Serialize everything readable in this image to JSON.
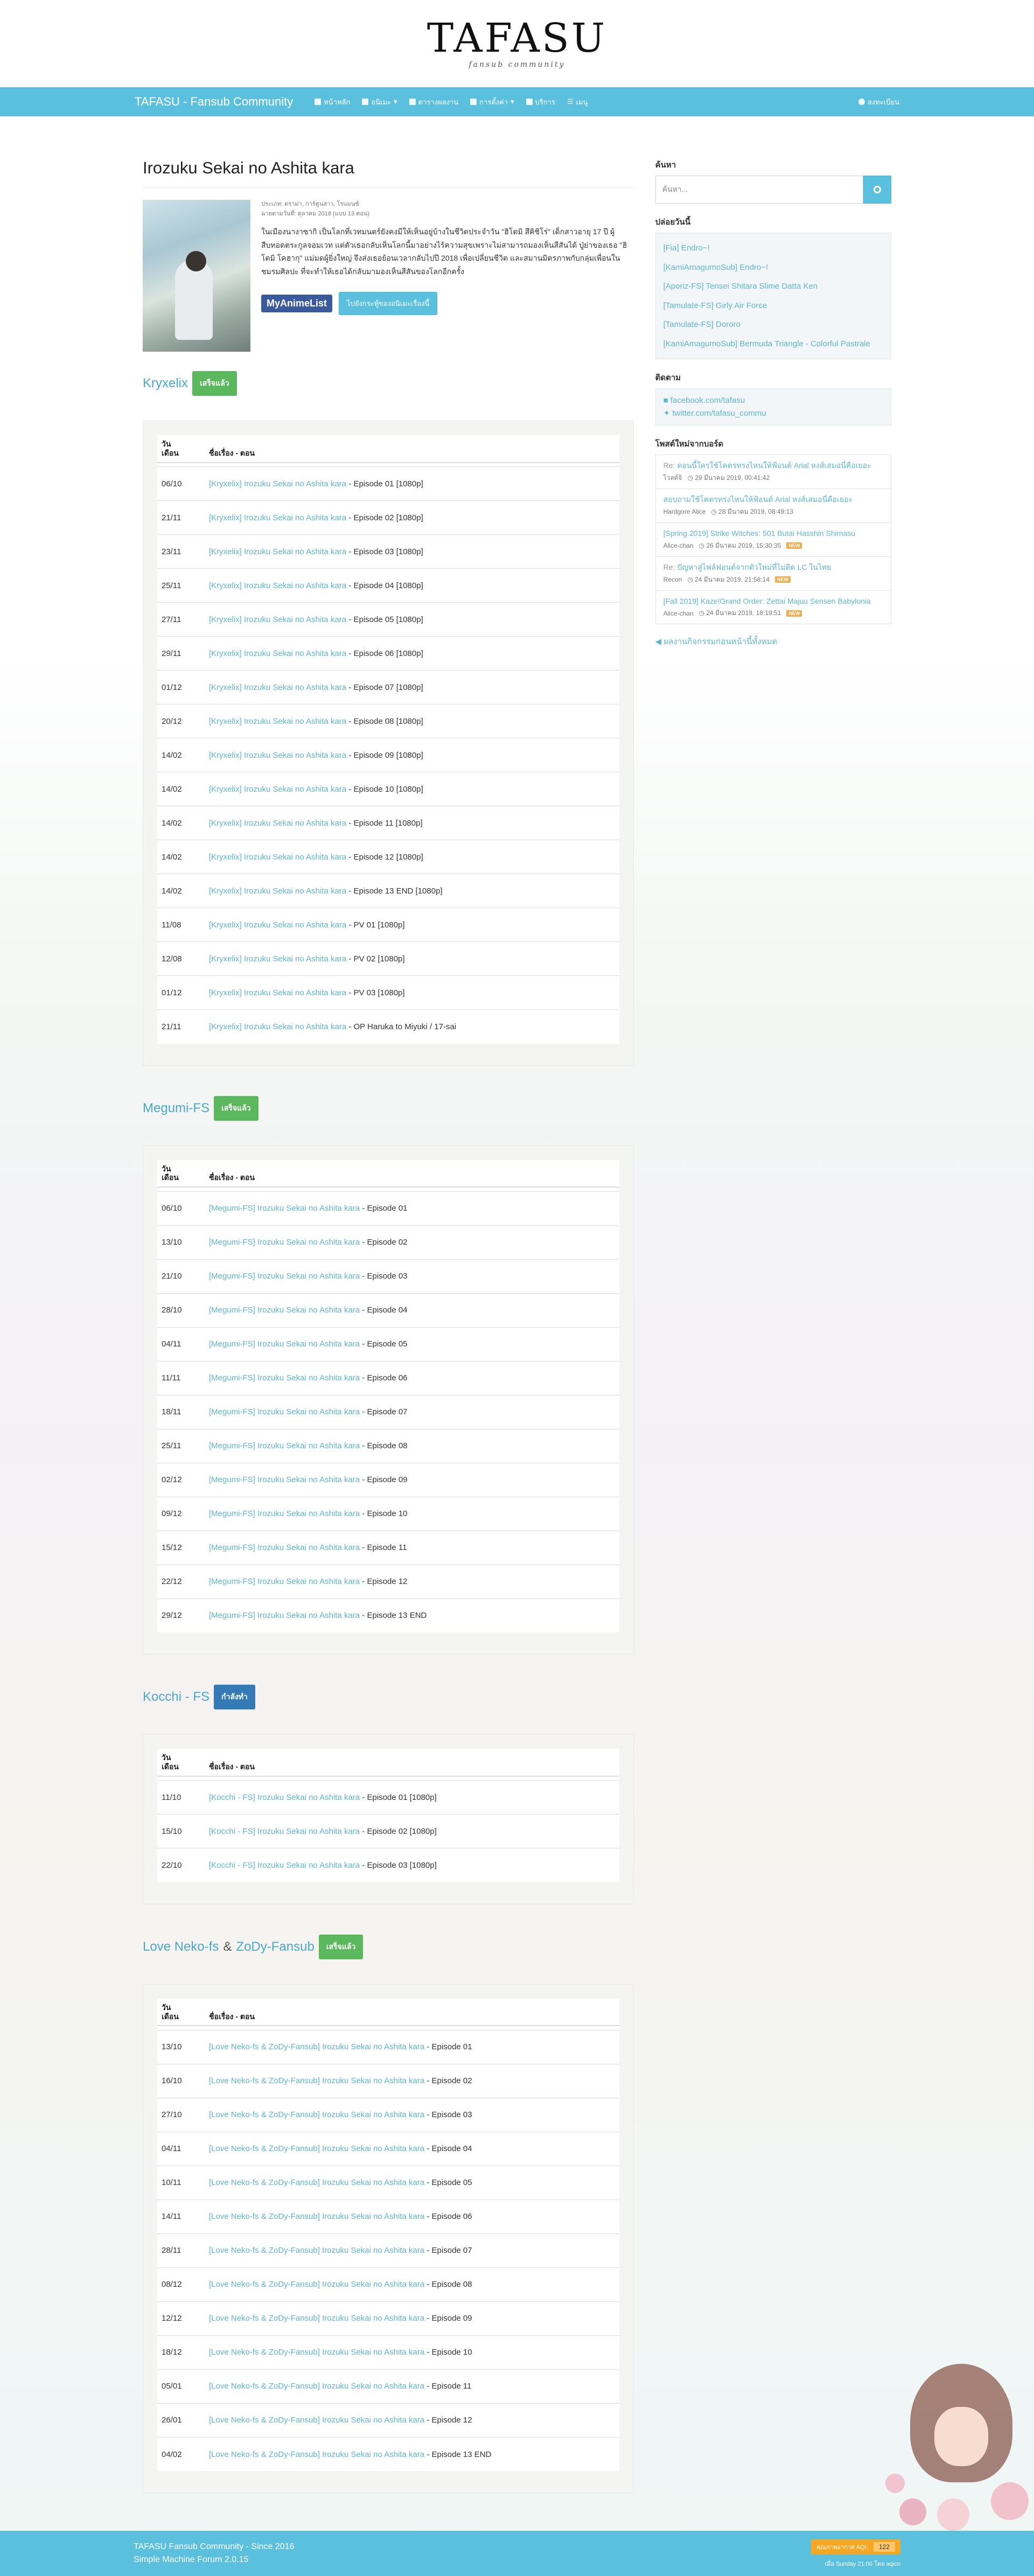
{
  "logo": {
    "title": "TAFASU",
    "subtitle": "fansub community"
  },
  "nav": {
    "brand": "TAFASU - Fansub Community",
    "items": [
      "หน้าหลัก",
      "อนิเมะ",
      "ตารางผลงาน",
      "การตั้งค่า",
      "บริการ",
      "เมนู"
    ],
    "login": "ลงทะเบียน"
  },
  "anime": {
    "title": "Irozuku Sekai no Ashita kara",
    "meta_line1": "ประเภท: ดราม่า, การ์ตูนสาว, โรแมนซ์",
    "meta_line2": "ฉายตามวันที่: ตุลาคม 2018 (แบบ 13 ตอน)",
    "synopsis": "ในเมืองนางาซากิ เป็นโลกที่เวทมนตร์ยังคงมีให้เห็นอยู่บ้างในชีวิตประจำวัน \"ฮิโตมิ สึคิชิโร่\" เด็กสาวอายุ 17 ปี ผู้สืบทอดตระกูลจอมเวท แต่ตัวเธอกลับเห็นโลกนี้มาอย่างไร้ความสุขเพราะไม่สามารถมองเห็นสีสันได้ ปู่ย่าของเธอ \"ฮิโตมิ โคฮากุ\" แม่มดผู้ยิ่งใหญ่ จึงส่งเธอย้อนเวลากลับไปปี 2018 เพื่อเปลี่ยนชีวิต และสมานมิตรภาพกับกลุ่มเพื่อนในชมรมศิลปะ ที่จะทำให้เธอได้กลับมามองเห็นสีสันของโลกอีกครั้ง",
    "mal_label": "MyAnimeList",
    "info_button": "ไปยังกระทู้ของอนิเมะเรื่องนี้"
  },
  "table_headers": {
    "date": "วัน\nเดือน",
    "title": "ชื่อเรื่อง - ตอน"
  },
  "groups": [
    {
      "name": "Kryxelix",
      "status": "เสร็จแล้ว",
      "status_type": "done",
      "rows": [
        {
          "date": "06/10",
          "link": "[Kryxelix] Irozuku Sekai no Ashita kara",
          "ep": "Episode 01 [1080p]"
        },
        {
          "date": "21/11",
          "link": "[Kryxelix] Irozuku Sekai no Ashita kara",
          "ep": "Episode 02 [1080p]"
        },
        {
          "date": "23/11",
          "link": "[Kryxelix] Irozuku Sekai no Ashita kara",
          "ep": "Episode 03 [1080p]"
        },
        {
          "date": "25/11",
          "link": "[Kryxelix] Irozuku Sekai no Ashita kara",
          "ep": "Episode 04 [1080p]"
        },
        {
          "date": "27/11",
          "link": "[Kryxelix] Irozuku Sekai no Ashita kara",
          "ep": "Episode 05 [1080p]"
        },
        {
          "date": "29/11",
          "link": "[Kryxelix] Irozuku Sekai no Ashita kara",
          "ep": "Episode 06 [1080p]"
        },
        {
          "date": "01/12",
          "link": "[Kryxelix] Irozuku Sekai no Ashita kara",
          "ep": "Episode 07 [1080p]"
        },
        {
          "date": "20/12",
          "link": "[Kryxelix] Irozuku Sekai no Ashita kara",
          "ep": "Episode 08 [1080p]"
        },
        {
          "date": "14/02",
          "link": "[Kryxelix] Irozuku Sekai no Ashita kara",
          "ep": "Episode 09 [1080p]"
        },
        {
          "date": "14/02",
          "link": "[Kryxelix] Irozuku Sekai no Ashita kara",
          "ep": "Episode 10 [1080p]"
        },
        {
          "date": "14/02",
          "link": "[Kryxelix] Irozuku Sekai no Ashita kara",
          "ep": "Episode 11 [1080p]"
        },
        {
          "date": "14/02",
          "link": "[Kryxelix] Irozuku Sekai no Ashita kara",
          "ep": "Episode 12 [1080p]"
        },
        {
          "date": "14/02",
          "link": "[Kryxelix] Irozuku Sekai no Ashita kara",
          "ep": "Episode 13 END [1080p]"
        },
        {
          "date": "11/08",
          "link": "[Kryxelix] Irozuku Sekai no Ashita kara",
          "ep": "PV 01 [1080p]"
        },
        {
          "date": "12/08",
          "link": "[Kryxelix] Irozuku Sekai no Ashita kara",
          "ep": "PV 02 [1080p]"
        },
        {
          "date": "01/12",
          "link": "[Kryxelix] Irozuku Sekai no Ashita kara",
          "ep": "PV 03 [1080p]"
        },
        {
          "date": "21/11",
          "link": "[Kryxelix] Irozuku Sekai no Ashita kara",
          "ep": "OP Haruka to Miyuki / 17-sai"
        }
      ]
    },
    {
      "name": "Megumi-FS",
      "status": "เสร็จแล้ว",
      "status_type": "done",
      "rows": [
        {
          "date": "06/10",
          "link": "[Megumi-FS] Irozuku Sekai no Ashita kara",
          "ep": "Episode 01"
        },
        {
          "date": "13/10",
          "link": "[Megumi-FS] Irozuku Sekai no Ashita kara",
          "ep": "Episode 02"
        },
        {
          "date": "21/10",
          "link": "[Megumi-FS] Irozuku Sekai no Ashita kara",
          "ep": "Episode 03"
        },
        {
          "date": "28/10",
          "link": "[Megumi-FS] Irozuku Sekai no Ashita kara",
          "ep": "Episode 04"
        },
        {
          "date": "04/11",
          "link": "[Megumi-FS] Irozuku Sekai no Ashita kara",
          "ep": "Episode 05"
        },
        {
          "date": "11/11",
          "link": "[Megumi-FS] Irozuku Sekai no Ashita kara",
          "ep": "Episode 06"
        },
        {
          "date": "18/11",
          "link": "[Megumi-FS] Irozuku Sekai no Ashita kara",
          "ep": "Episode 07"
        },
        {
          "date": "25/11",
          "link": "[Megumi-FS] Irozuku Sekai no Ashita kara",
          "ep": "Episode 08"
        },
        {
          "date": "02/12",
          "link": "[Megumi-FS] Irozuku Sekai no Ashita kara",
          "ep": "Episode 09"
        },
        {
          "date": "09/12",
          "link": "[Megumi-FS] Irozuku Sekai no Ashita kara",
          "ep": "Episode 10"
        },
        {
          "date": "15/12",
          "link": "[Megumi-FS] Irozuku Sekai no Ashita kara",
          "ep": "Episode 11"
        },
        {
          "date": "22/12",
          "link": "[Megumi-FS] Irozuku Sekai no Ashita kara",
          "ep": "Episode 12"
        },
        {
          "date": "29/12",
          "link": "[Megumi-FS] Irozuku Sekai no Ashita kara",
          "ep": "Episode 13 END"
        }
      ]
    },
    {
      "name": "Kocchi - FS",
      "status": "กำลังทำ",
      "status_type": "ongoing",
      "rows": [
        {
          "date": "11/10",
          "link": "[Kocchi - FS] Irozuku Sekai no Ashita kara",
          "ep": "Episode 01 [1080p]"
        },
        {
          "date": "15/10",
          "link": "[Kocchi - FS] Irozuku Sekai no Ashita kara",
          "ep": "Episode 02 [1080p]"
        },
        {
          "date": "22/10",
          "link": "[Kocchi - FS] Irozuku Sekai no Ashita kara",
          "ep": "Episode 03 [1080p]"
        }
      ]
    },
    {
      "name": "Love Neko-fs",
      "name2": "ZoDy-Fansub",
      "status": "เสร็จแล้ว",
      "status_type": "done",
      "rows": [
        {
          "date": "13/10",
          "link": "[Love Neko-fs & ZoDy-Fansub] Irozuku Sekai no Ashita kara",
          "ep": "Episode 01"
        },
        {
          "date": "16/10",
          "link": "[Love Neko-fs & ZoDy-Fansub] Irozuku Sekai no Ashita kara",
          "ep": "Episode 02"
        },
        {
          "date": "27/10",
          "link": "[Love Neko-fs & ZoDy-Fansub] Irozuku Sekai no Ashita kara",
          "ep": "Episode 03"
        },
        {
          "date": "04/11",
          "link": "[Love Neko-fs & ZoDy-Fansub] Irozuku Sekai no Ashita kara",
          "ep": "Episode 04"
        },
        {
          "date": "10/11",
          "link": "[Love Neko-fs & ZoDy-Fansub] Irozuku Sekai no Ashita kara",
          "ep": "Episode 05"
        },
        {
          "date": "14/11",
          "link": "[Love Neko-fs & ZoDy-Fansub] Irozuku Sekai no Ashita kara",
          "ep": "Episode 06"
        },
        {
          "date": "28/11",
          "link": "[Love Neko-fs & ZoDy-Fansub] Irozuku Sekai no Ashita kara",
          "ep": "Episode 07"
        },
        {
          "date": "08/12",
          "link": "[Love Neko-fs & ZoDy-Fansub] Irozuku Sekai no Ashita kara",
          "ep": "Episode 08"
        },
        {
          "date": "12/12",
          "link": "[Love Neko-fs & ZoDy-Fansub] Irozuku Sekai no Ashita kara",
          "ep": "Episode 09"
        },
        {
          "date": "18/12",
          "link": "[Love Neko-fs & ZoDy-Fansub] Irozuku Sekai no Ashita kara",
          "ep": "Episode 10"
        },
        {
          "date": "05/01",
          "link": "[Love Neko-fs & ZoDy-Fansub] Irozuku Sekai no Ashita kara",
          "ep": "Episode 11"
        },
        {
          "date": "26/01",
          "link": "[Love Neko-fs & ZoDy-Fansub] Irozuku Sekai no Ashita kara",
          "ep": "Episode 12"
        },
        {
          "date": "04/02",
          "link": "[Love Neko-fs & ZoDy-Fansub] Irozuku Sekai no Ashita kara",
          "ep": "Episode 13 END"
        }
      ]
    }
  ],
  "sidebar": {
    "search_title": "ค้นหา",
    "search_placeholder": "ค้นหา...",
    "related_title": "ปล่อยวันนี้",
    "related": [
      "[Fia] Endro~!",
      "[KamiAmagumoSub] Endro~!",
      "[Aporiz-FS] Tensei Shitara Slime Datta Ken",
      "[Tamulate-FS] Girly Air Force",
      "[Tamulate-FS] Dororo",
      "[KamiAmagumoSub] Bermuda Triangle - Colorful Pastrale"
    ],
    "contact_title": "ติดตาม",
    "contact": [
      "facebook.com/tafasu",
      "twitter.com/tafasu_commu"
    ],
    "topics_title": "โพสต์ใหม่จากบอร์ด",
    "topics": [
      {
        "re": "Re:",
        "title": "ตอนนี้ใครใช้โคตรทรงไหนให้ฟ้อนต์ Arial หงส์เสมอนี่คือเยอะ",
        "user": "ไวลด์จิ",
        "time": "29 มีนาคม 2019, 00:41:42",
        "new": ""
      },
      {
        "re": "",
        "title": "สอบถามใช้โคตรทรงไหนให้ฟ้อนต์ Arial หงส์เสมอนี่คือเยอะ",
        "user": "Hardgore Alice",
        "time": "28 มีนาคม 2019, 08:49:13",
        "new": ""
      },
      {
        "re": "",
        "title": "[Spring 2019] Strike Witches: 501 Butai Hasshin Shimasu",
        "user": "Alice-chan",
        "time": "26 มีนาคม 2019, 15:30:35",
        "new": "NEW"
      },
      {
        "re": "Re:",
        "title": "ปัญหาสู่ไฟล์ฟอนต์จากตัวใหม่ที่ไม่ติด LC ในไทย",
        "user": "Recon",
        "time": "24 มีนาคม 2019, 21:58:14",
        "new": "NEW"
      },
      {
        "re": "",
        "title": "[Fall 2019] Kaze!Grand Order: Zettai Majuu Sensen Babylonia",
        "user": "Alice-chan",
        "time": "24 มีนาคม 2019, 18:19:51",
        "new": "NEW"
      }
    ],
    "prev_link": "ผลงานกิจกรรมก่อนหน้านี้ทั้งหมด"
  },
  "footer": {
    "line1": "TAFASU Fansub Community - Since 2016",
    "line2": "Simple Machine Forum 2.0.15",
    "aqi_label": "คุณภาพอากาศ AQI:",
    "aqi_value": "122",
    "last": "เมื่อ Sunday 21:00 โดย aqicn"
  },
  "colors": {
    "accent": "#5bc0de",
    "link": "#5fb5cf",
    "done": "#5cb85c",
    "ongoing": "#337ab7"
  }
}
